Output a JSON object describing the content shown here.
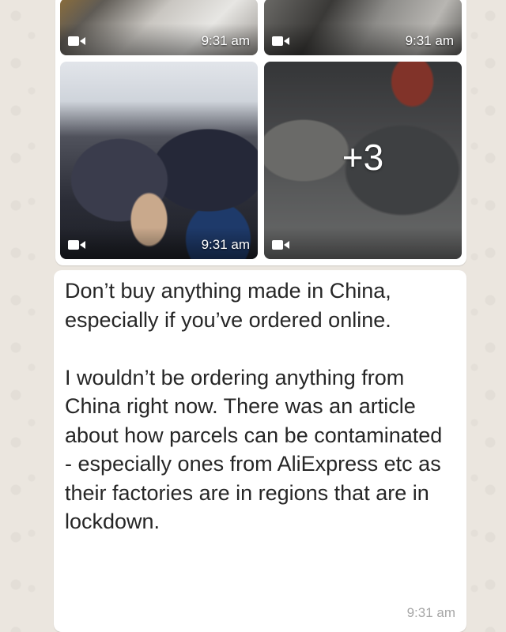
{
  "media_group": {
    "tiles": [
      {
        "time": "9:31 am",
        "icon": "video-camera-icon"
      },
      {
        "time": "9:31 am",
        "icon": "video-camera-icon"
      },
      {
        "time": "9:31 am",
        "icon": "video-camera-icon"
      },
      {
        "time": "",
        "icon": "video-camera-icon",
        "more_count": "+3"
      }
    ]
  },
  "message": {
    "paragraph_1": "Don’t buy anything made in China, especially if you’ve ordered online.",
    "paragraph_2": "I wouldn’t be ordering anything from China right now. There was an article about how parcels can be contaminated - especially ones from AliExpress etc as their factories are in regions that are in lockdown.",
    "time": "9:31 am"
  },
  "colors": {
    "wallpaper": "#ebe6df",
    "bubble": "#ffffff",
    "timestamp": "#a7a7a7"
  }
}
